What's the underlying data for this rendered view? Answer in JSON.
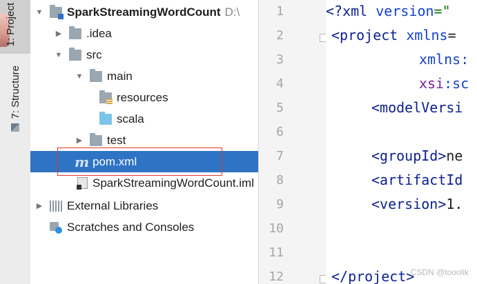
{
  "tool_stripe": {
    "project_tab": "1: Project",
    "structure_tab": "7: Structure"
  },
  "project_tree": {
    "root_name": "SparkStreamingWordCount",
    "root_path": "D:\\",
    "items": [
      {
        "label": ".idea"
      },
      {
        "label": "src"
      },
      {
        "label": "main"
      },
      {
        "label": "resources"
      },
      {
        "label": "scala"
      },
      {
        "label": "test"
      },
      {
        "label": "pom.xml"
      },
      {
        "label": "SparkStreamingWordCount.iml"
      },
      {
        "label": "External Libraries"
      },
      {
        "label": "Scratches and Consoles"
      }
    ]
  },
  "editor": {
    "line_numbers": [
      "1",
      "2",
      "3",
      "4",
      "5",
      "6",
      "7",
      "8",
      "9",
      "10",
      "11",
      "12"
    ],
    "lines": {
      "l1_a": "<?xml ",
      "l1_b": "version",
      "l1_c": "=\"",
      "l2_a": "<project ",
      "l2_b": "xmlns",
      "l3_b": "xmlns:",
      "l4_a": "xsi",
      "l4_b": ":sc",
      "l5": "<modelVersi",
      "l7_a": "<groupId>",
      "l7_b": "ne",
      "l8": "<artifactId",
      "l9_a": "<version>",
      "l9_b": "1.",
      "l12": "</project>"
    }
  },
  "watermark": "CSDN @tooolik",
  "colors": {
    "selection": "#2f73c4",
    "highlight_box": "#e0332e"
  }
}
